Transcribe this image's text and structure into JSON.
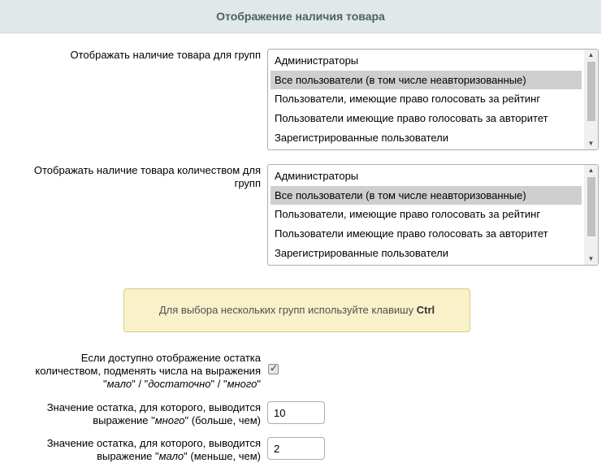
{
  "header": {
    "title": "Отображение наличия товара"
  },
  "group_availability": {
    "label": "Отображать наличие товара для групп",
    "options": [
      {
        "label": "Администраторы",
        "selected": false
      },
      {
        "label": "Все пользователи (в том числе неавторизованные)",
        "selected": true
      },
      {
        "label": "Пользователи, имеющие право голосовать за рейтинг",
        "selected": false
      },
      {
        "label": "Пользователи имеющие право голосовать за авторитет",
        "selected": false
      },
      {
        "label": "Зарегистрированные пользователи",
        "selected": false
      }
    ]
  },
  "group_quantity": {
    "label_line1": "Отображать наличие товара количеством для",
    "label_line2": "групп",
    "options": [
      {
        "label": "Администраторы",
        "selected": false
      },
      {
        "label": "Все пользователи (в том числе неавторизованные)",
        "selected": true
      },
      {
        "label": "Пользователи, имеющие право голосовать за рейтинг",
        "selected": false
      },
      {
        "label": "Пользователи имеющие право голосовать за авторитет",
        "selected": false
      },
      {
        "label": "Зарегистрированные пользователи",
        "selected": false
      }
    ]
  },
  "notice": {
    "text": "Для выбора нескольких групп используйте клавишу ",
    "key": "Ctrl"
  },
  "replace_numbers": {
    "line1": "Если доступно отображение остатка",
    "line2": "количеством, подменять числа на выражения",
    "line3_q1": "\"",
    "line3_w1": "мало",
    "line3_sep1": "\" / \"",
    "line3_w2": "достаточно",
    "line3_sep2": "\" / \"",
    "line3_w3": "много",
    "line3_q2": "\"",
    "checked": true
  },
  "many_threshold": {
    "line1": "Значение остатка, для которого, выводится",
    "line2_pre": "выражение \"",
    "line2_word": "много",
    "line2_post": "\" (больше, чем)",
    "value": "10"
  },
  "few_threshold": {
    "line1": "Значение остатка, для которого, выводится",
    "line2_pre": "выражение \"",
    "line2_word": "мало",
    "line2_post": "\" (меньше, чем)",
    "value": "2"
  }
}
